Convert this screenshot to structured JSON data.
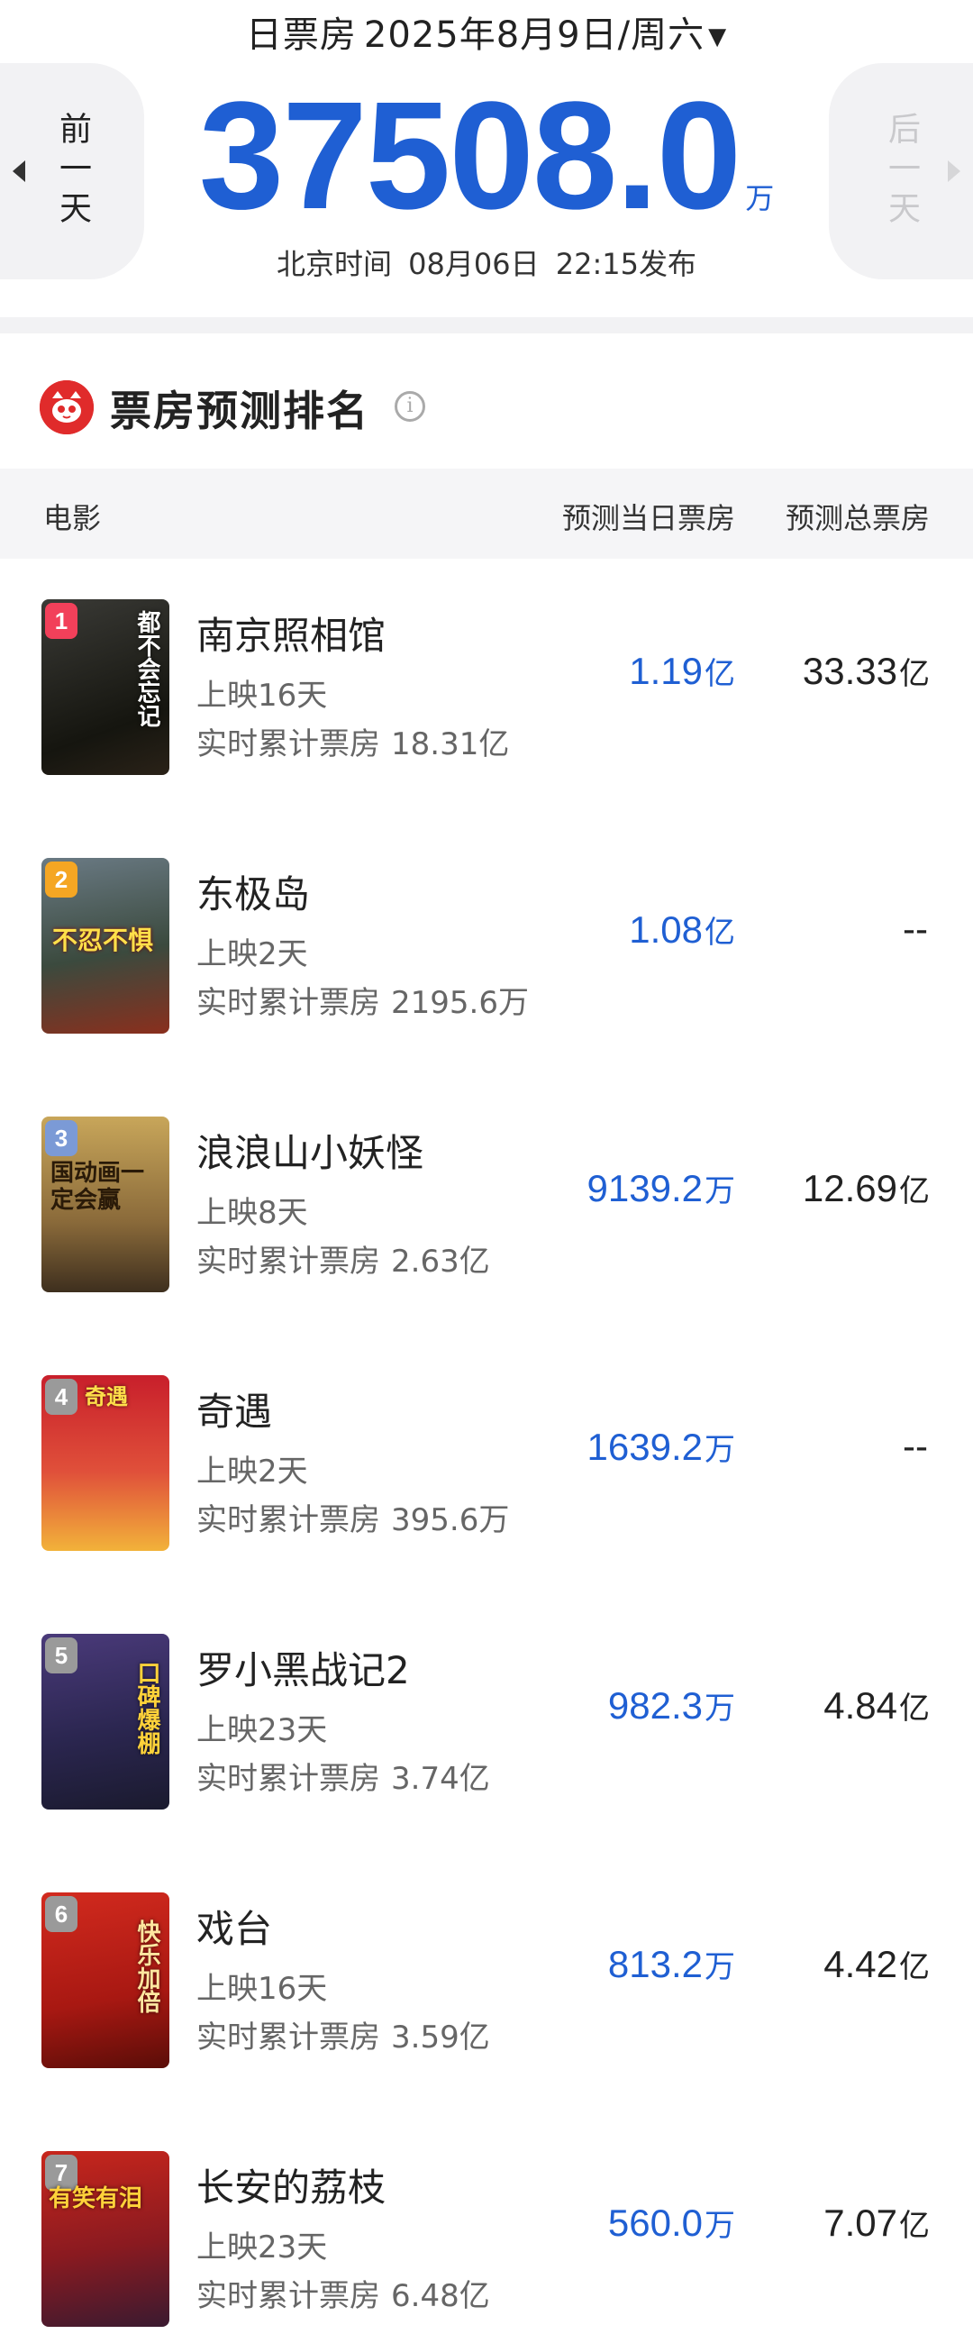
{
  "header": {
    "title": "日票房",
    "date": "2025年8月9日/周六",
    "prev_day_label": "前一天",
    "next_day_label": "后一天",
    "total_value": "37508.0",
    "total_unit": "万",
    "publish_text": "北京时间 08月06日 22:15发布"
  },
  "section": {
    "title": "票房预测排名"
  },
  "table": {
    "col_movie": "电影",
    "col_day_forecast": "预测当日票房",
    "col_total_forecast": "预测总票房"
  },
  "colors": {
    "accent_blue": "#1f5fd3",
    "logo_red": "#e02b2b"
  },
  "movies": [
    {
      "rank": "1",
      "name": "南京照相馆",
      "days": "上映16天",
      "cum_label": "实时累计票房",
      "cum_value": "18.31亿",
      "day_value": "1.19",
      "day_unit": "亿",
      "total_value": "33.33",
      "total_unit": "亿",
      "rank_color": "#f2405a",
      "poster_text": "都不会忘记"
    },
    {
      "rank": "2",
      "name": "东极岛",
      "days": "上映2天",
      "cum_label": "实时累计票房",
      "cum_value": "2195.6万",
      "day_value": "1.08",
      "day_unit": "亿",
      "total_value": "--",
      "total_unit": "",
      "rank_color": "#f5a623",
      "poster_text": "不忍不惧"
    },
    {
      "rank": "3",
      "name": "浪浪山小妖怪",
      "days": "上映8天",
      "cum_label": "实时累计票房",
      "cum_value": "2.63亿",
      "day_value": "9139.2",
      "day_unit": "万",
      "total_value": "12.69",
      "total_unit": "亿",
      "rank_color": "#7b9ad6",
      "poster_text": "国动画一定会赢"
    },
    {
      "rank": "4",
      "name": "奇遇",
      "days": "上映2天",
      "cum_label": "实时累计票房",
      "cum_value": "395.6万",
      "day_value": "1639.2",
      "day_unit": "万",
      "total_value": "--",
      "total_unit": "",
      "rank_color": "#9a9a9a",
      "poster_text": "奇遇"
    },
    {
      "rank": "5",
      "name": "罗小黑战记2",
      "days": "上映23天",
      "cum_label": "实时累计票房",
      "cum_value": "3.74亿",
      "day_value": "982.3",
      "day_unit": "万",
      "total_value": "4.84",
      "total_unit": "亿",
      "rank_color": "#9a9a9a",
      "poster_text": "口碑爆棚"
    },
    {
      "rank": "6",
      "name": "戏台",
      "days": "上映16天",
      "cum_label": "实时累计票房",
      "cum_value": "3.59亿",
      "day_value": "813.2",
      "day_unit": "万",
      "total_value": "4.42",
      "total_unit": "亿",
      "rank_color": "#9a9a9a",
      "poster_text": "快乐加倍"
    },
    {
      "rank": "7",
      "name": "长安的荔枝",
      "days": "上映23天",
      "cum_label": "实时累计票房",
      "cum_value": "6.48亿",
      "day_value": "560.0",
      "day_unit": "万",
      "total_value": "7.07",
      "total_unit": "亿",
      "rank_color": "#9a9a9a",
      "poster_text": "有笑有泪"
    }
  ]
}
